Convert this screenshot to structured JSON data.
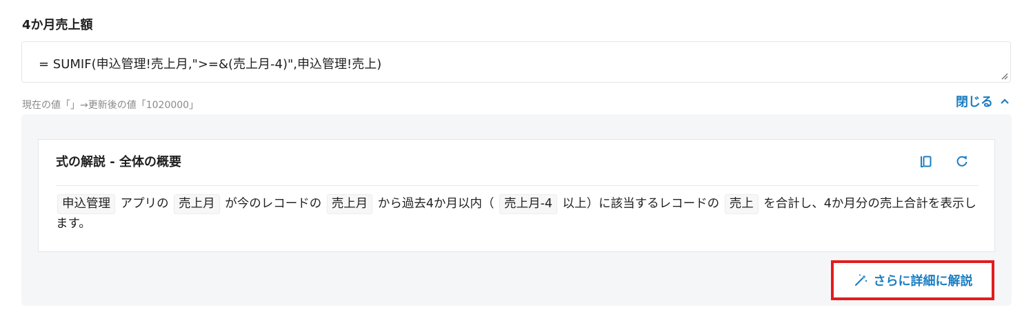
{
  "field": {
    "label": "4か月売上額",
    "formula": "= SUMIF(申込管理!売上月,\">=&(売上月-4)\",申込管理!売上)",
    "status": "現在の値「」→更新後の値「1020000」"
  },
  "toggle": {
    "label": "閉じる",
    "icon": "chevron-up-icon"
  },
  "card": {
    "title": "式の解説 - 全体の概要",
    "copy_icon": "copy-icon",
    "refresh_icon": "refresh-icon",
    "explanation": {
      "chip1": "申込管理",
      "t1": "アプリの",
      "chip2": "売上月",
      "t2": "が今のレコードの",
      "chip3": "売上月",
      "t3": "から過去4か月以内（",
      "chip4": "売上月-4",
      "t4": "以上）に該当するレコードの",
      "chip5": "売上",
      "t5": "を合計し、4か月分の売上合計を表示します。"
    }
  },
  "detail_button": {
    "label": "さらに詳細に解説",
    "icon": "magic-wand-icon"
  },
  "colors": {
    "accent": "#1a7ec2",
    "highlight": "#e21c1c",
    "panel": "#f5f6f8"
  }
}
